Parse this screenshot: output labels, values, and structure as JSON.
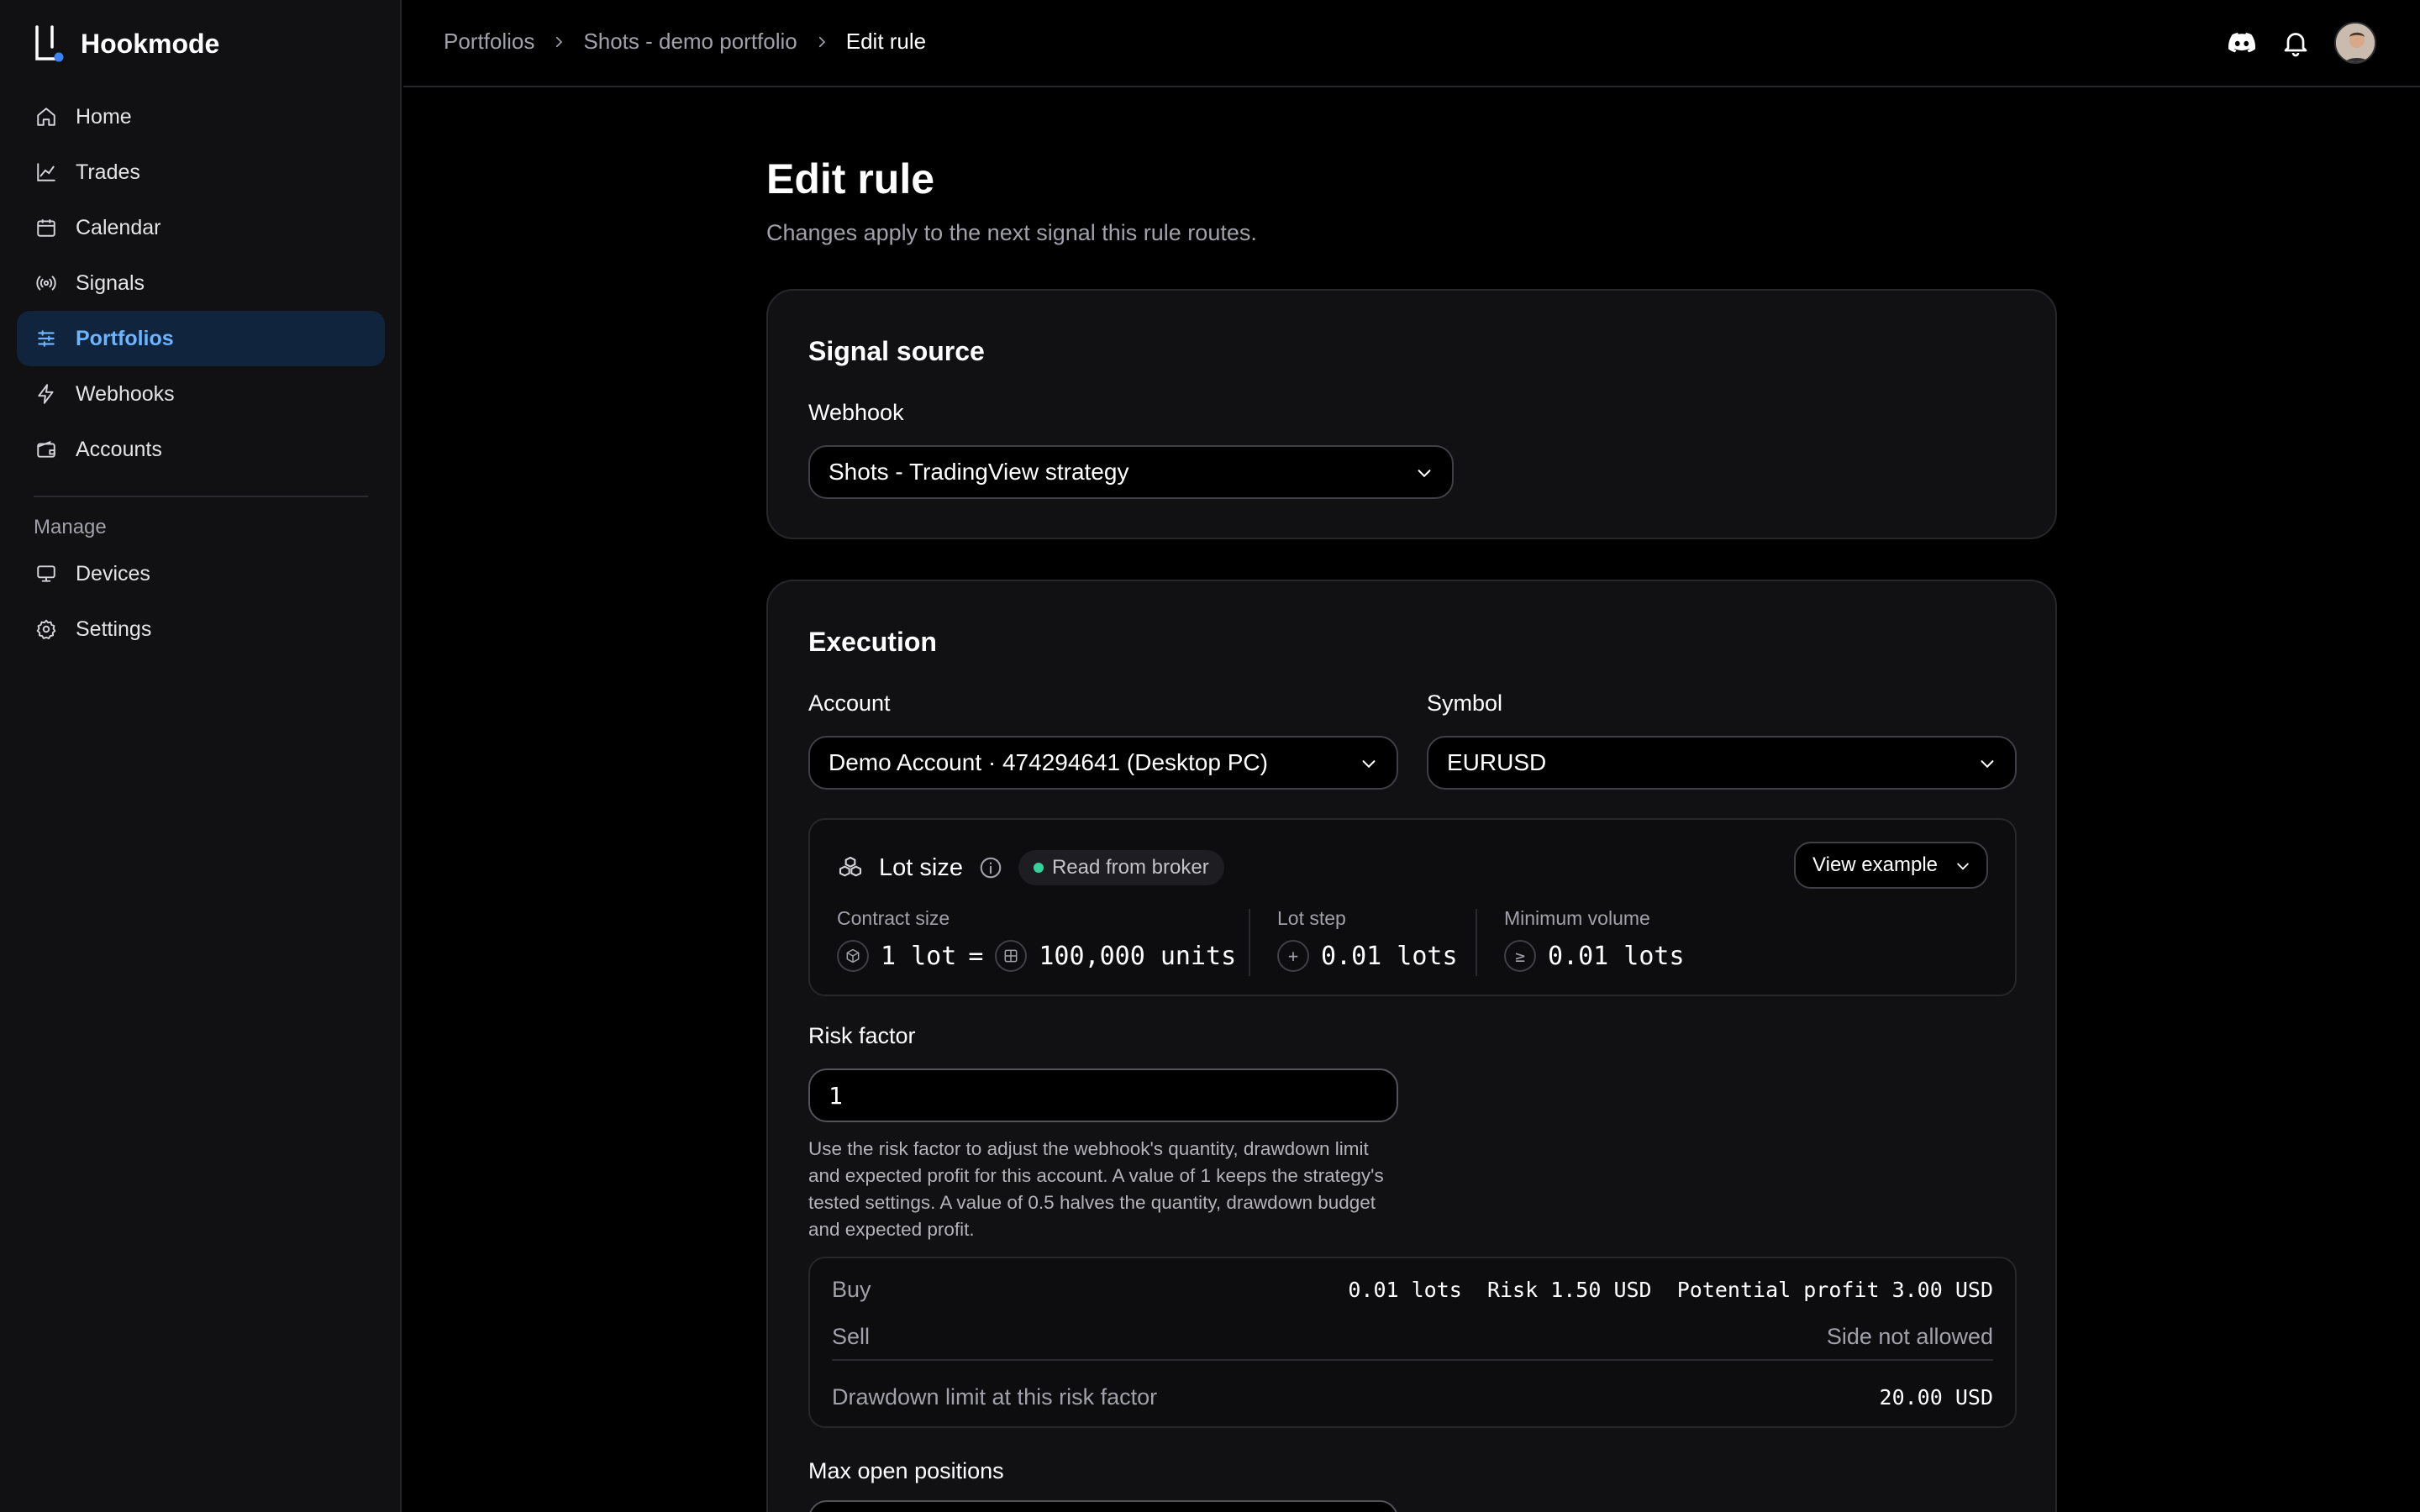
{
  "app": {
    "name": "Hookmode"
  },
  "sidebar": {
    "items": [
      {
        "label": "Home",
        "icon": "home-icon"
      },
      {
        "label": "Trades",
        "icon": "chart-line-icon"
      },
      {
        "label": "Calendar",
        "icon": "calendar-icon"
      },
      {
        "label": "Signals",
        "icon": "broadcast-icon"
      },
      {
        "label": "Portfolios",
        "icon": "sliders-icon",
        "active": true
      },
      {
        "label": "Webhooks",
        "icon": "bolt-icon"
      },
      {
        "label": "Accounts",
        "icon": "wallet-icon"
      }
    ],
    "manage_heading": "Manage",
    "manage_items": [
      {
        "label": "Devices",
        "icon": "monitor-icon"
      },
      {
        "label": "Settings",
        "icon": "gear-icon"
      }
    ]
  },
  "breadcrumb": [
    "Portfolios",
    "Shots - demo portfolio",
    "Edit rule"
  ],
  "page": {
    "title": "Edit rule",
    "subtitle": "Changes apply to the next signal this rule routes."
  },
  "signal_source": {
    "title": "Signal source",
    "webhook_label": "Webhook",
    "webhook_value": "Shots - TradingView strategy"
  },
  "execution": {
    "title": "Execution",
    "account_label": "Account",
    "account_value": "Demo Account · 474294641 (Desktop PC)",
    "symbol_label": "Symbol",
    "symbol_value": "EURUSD",
    "lot": {
      "title": "Lot size",
      "badge": "Read from broker",
      "view_example": "View example",
      "contract_label": "Contract size",
      "contract_lot": "1 lot",
      "contract_eq": "=",
      "contract_units": "100,000 units",
      "step_label": "Lot step",
      "step_value": "0.01 lots",
      "min_label": "Minimum volume",
      "min_value": "0.01 lots"
    },
    "risk_label": "Risk factor",
    "risk_value": "1",
    "risk_help": "Use the risk factor to adjust the webhook's quantity, drawdown limit and expected profit for this account. A value of 1 keeps the strategy's tested settings. A value of 0.5 halves the quantity, drawdown budget and expected profit.",
    "summary": {
      "buy_label": "Buy",
      "buy_value": "0.01 lots  Risk 1.50 USD  Potential profit 3.00 USD",
      "sell_label": "Sell",
      "sell_value": "Side not allowed",
      "drawdown_label": "Drawdown limit at this risk factor",
      "drawdown_value": "20.00 USD"
    },
    "max_positions_label": "Max open positions"
  },
  "colors": {
    "accent": "#6cb4ff",
    "active_bg": "#10253d",
    "success": "#34d399",
    "card": "#111113"
  }
}
